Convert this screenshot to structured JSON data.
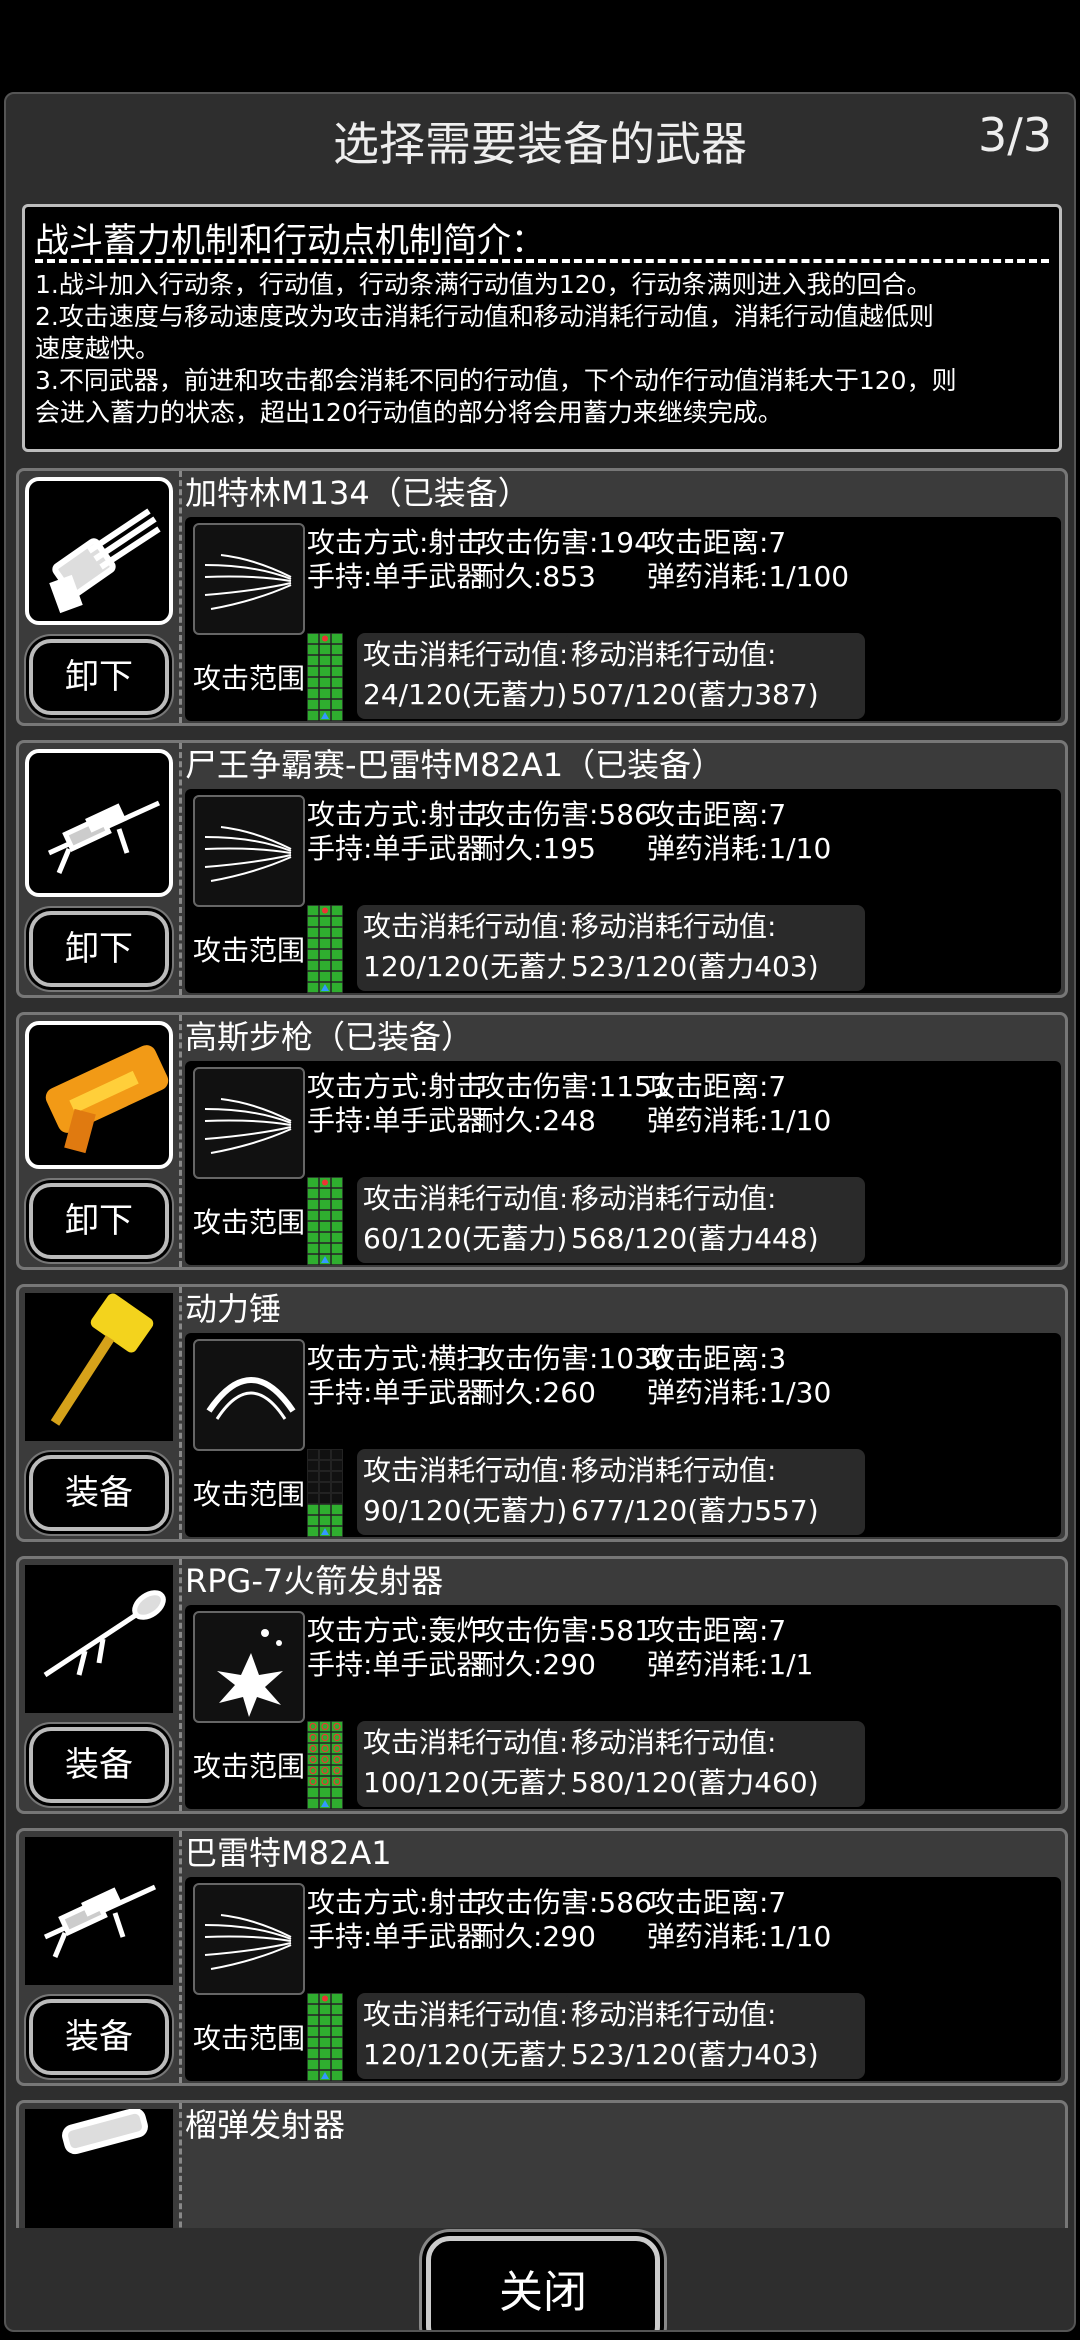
{
  "dialog": {
    "title": "选择需要装备的武器",
    "page_indicator": "3/3",
    "close_label": "关闭"
  },
  "intro": {
    "title": "战斗蓄力机制和行动点机制简介：",
    "lines": [
      "1.战斗加入行动条，行动值，行动条满行动值为120，行动条满则进入我的回合。",
      "2.攻击速度与移动速度改为攻击消耗行动值和移动消耗行动值，消耗行动值越低则",
      "速度越快。",
      "3.不同武器，前进和攻击都会消耗不同的行动值，下个动作行动值消耗大于120，则",
      "会进入蓄力的状态，超出120行动值的部分将会用蓄力来继续完成。"
    ]
  },
  "labels": {
    "range": "攻击范围:",
    "atk_cost_title": "攻击消耗行动值:",
    "move_cost_title": "移动消耗行动值:"
  },
  "weapons": [
    {
      "name": "加特林M134（已装备）",
      "button": "卸下",
      "icon": "gatling-icon",
      "skill_icon": "shoot-icon",
      "attack_type": "攻击方式:射击",
      "damage": "攻击伤害:194",
      "distance": "攻击距离:7",
      "hold": "手持:单手武器",
      "durability": "耐久:853",
      "ammo": "弹药消耗:1/100",
      "atk_cost": "24/120(无蓄力)",
      "move_cost": "507/120(蓄力387)"
    },
    {
      "name": "尸王争霸赛-巴雷特M82A1（已装备）",
      "button": "卸下",
      "icon": "sniper-rifle-icon",
      "skill_icon": "shoot-icon",
      "attack_type": "攻击方式:射击",
      "damage": "攻击伤害:586",
      "distance": "攻击距离:7",
      "hold": "手持:单手武器",
      "durability": "耐久:195",
      "ammo": "弹药消耗:1/10",
      "atk_cost": "120/120(无蓄力)",
      "move_cost": "523/120(蓄力403)"
    },
    {
      "name": "高斯步枪（已装备）",
      "button": "卸下",
      "icon": "gauss-rifle-icon",
      "skill_icon": "shoot-icon",
      "attack_type": "攻击方式:射击",
      "damage": "攻击伤害:1151",
      "distance": "攻击距离:7",
      "hold": "手持:单手武器",
      "durability": "耐久:248",
      "ammo": "弹药消耗:1/10",
      "atk_cost": "60/120(无蓄力)",
      "move_cost": "568/120(蓄力448)"
    },
    {
      "name": "动力锤",
      "button": "装备",
      "icon": "power-hammer-icon",
      "skill_icon": "sweep-icon",
      "attack_type": "攻击方式:横扫",
      "damage": "攻击伤害:1030",
      "distance": "攻击距离:3",
      "hold": "手持:单手武器",
      "durability": "耐久:260",
      "ammo": "弹药消耗:1/30",
      "atk_cost": "90/120(无蓄力)",
      "move_cost": "677/120(蓄力557)"
    },
    {
      "name": "RPG-7火箭发射器",
      "button": "装备",
      "icon": "rocket-launcher-icon",
      "skill_icon": "explosion-icon",
      "attack_type": "攻击方式:轰炸",
      "damage": "攻击伤害:581",
      "distance": "攻击距离:7",
      "hold": "手持:单手武器",
      "durability": "耐久:290",
      "ammo": "弹药消耗:1/1",
      "atk_cost": "100/120(无蓄力)",
      "move_cost": "580/120(蓄力460)"
    },
    {
      "name": "巴雷特M82A1",
      "button": "装备",
      "icon": "sniper-rifle-icon",
      "skill_icon": "shoot-icon",
      "attack_type": "攻击方式:射击",
      "damage": "攻击伤害:586",
      "distance": "攻击距离:7",
      "hold": "手持:单手武器",
      "durability": "耐久:290",
      "ammo": "弹药消耗:1/10",
      "atk_cost": "120/120(无蓄力)",
      "move_cost": "523/120(蓄力403)"
    },
    {
      "name": "榴弹发射器",
      "button": "",
      "icon": "grenade-launcher-icon",
      "skill_icon": "",
      "attack_type": "",
      "damage": "",
      "distance": "",
      "hold": "",
      "durability": "",
      "ammo": "",
      "atk_cost": "",
      "move_cost": ""
    }
  ]
}
